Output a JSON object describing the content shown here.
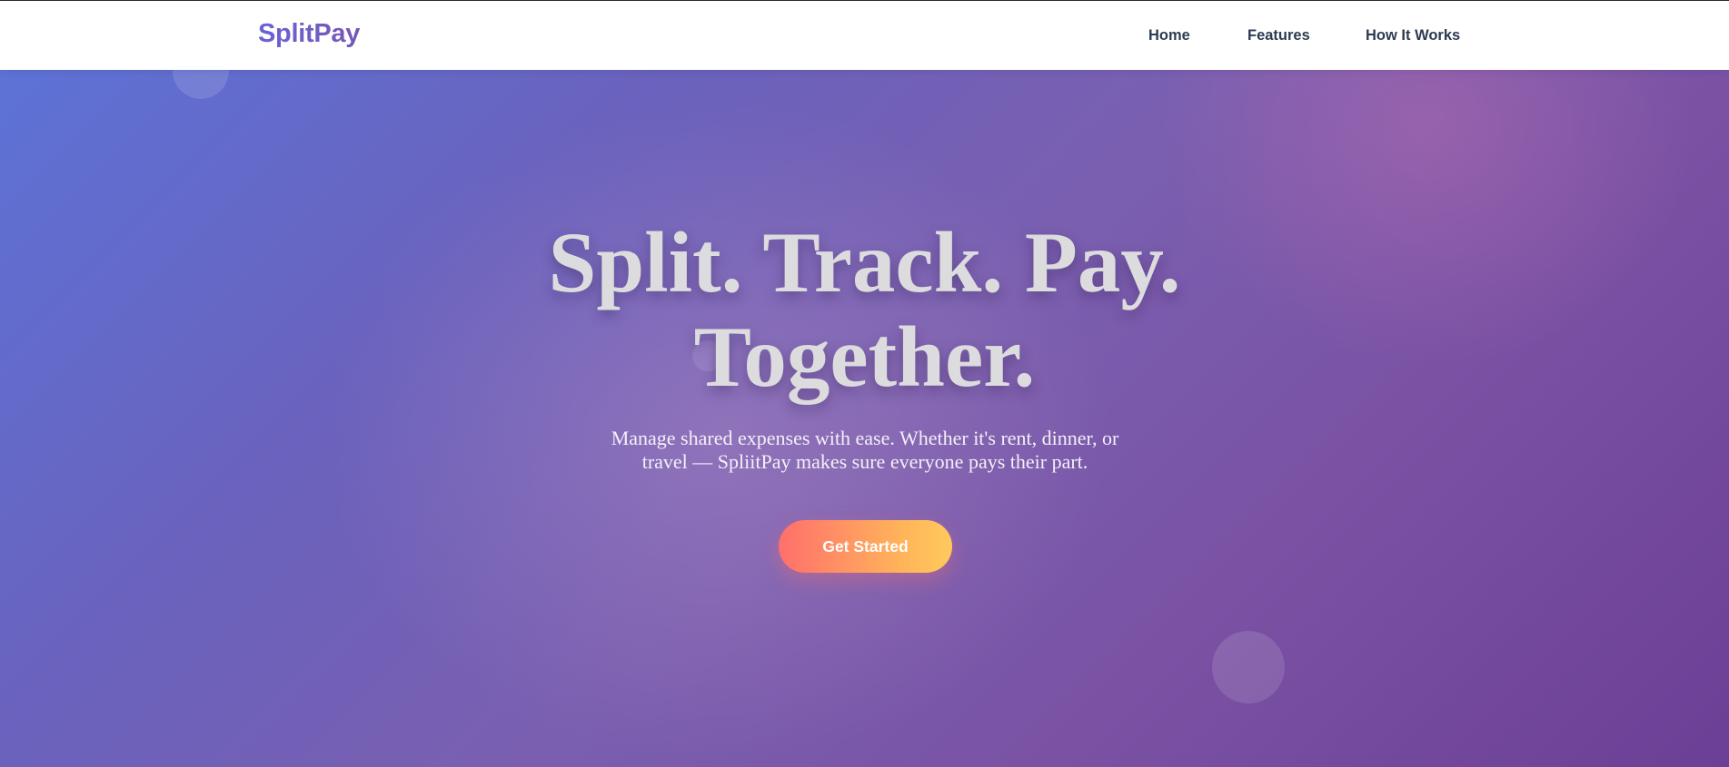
{
  "navbar": {
    "brand": "SplitPay",
    "links": [
      {
        "label": "Home"
      },
      {
        "label": "Features"
      },
      {
        "label": "How It Works"
      }
    ]
  },
  "hero": {
    "headline_line1": "Split. Track. Pay.",
    "headline_line2": "Together.",
    "subtitle": "Manage shared expenses with ease. Whether it's rent, dinner, or travel — SpliitPay makes sure everyone pays their part.",
    "cta_label": "Get Started"
  },
  "colors": {
    "brand_gradient_start": "#6a63d4",
    "brand_gradient_end": "#7656b4",
    "hero_gradient_start": "#5d72d6",
    "hero_gradient_end": "#6b3f95",
    "cta_gradient_start": "#ff6f6c",
    "cta_gradient_end": "#ffc95d",
    "nav_text": "#2e3b50"
  }
}
